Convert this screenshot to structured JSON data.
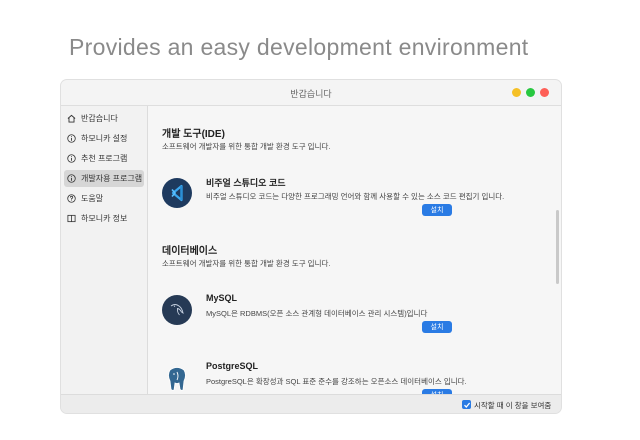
{
  "headline": "Provides an easy development environment",
  "window": {
    "title": "반갑습니다",
    "traffic_lights": [
      "#f5c026",
      "#28c840",
      "#fe5f57"
    ]
  },
  "sidebar": {
    "items": [
      {
        "label": "반갑습니다",
        "icon": "home-icon"
      },
      {
        "label": "하모니카 설정",
        "icon": "info-icon"
      },
      {
        "label": "추천 프로그램",
        "icon": "info-icon"
      },
      {
        "label": "개발자용 프로그램",
        "icon": "info-icon",
        "active": true
      },
      {
        "label": "도움말",
        "icon": "help-icon"
      },
      {
        "label": "하모니카 정보",
        "icon": "book-icon"
      }
    ]
  },
  "sections": [
    {
      "title": "개발 도구(IDE)",
      "description": "소프트웨어 개발자를 위한 통합 개발 환경 도구 입니다.",
      "apps": [
        {
          "name": "비주얼 스튜디오 코드",
          "description": "비주얼 스튜디오 코드는 다양한 프로그래밍 언어와 함께 사용할 수 있는 소스 코드 편집기 입니다.",
          "button": "설치",
          "icon": "vscode-icon"
        }
      ]
    },
    {
      "title": "데이터베이스",
      "description": "소프트웨어 개발자를 위한 통합 개발 환경 도구 입니다.",
      "apps": [
        {
          "name": "MySQL",
          "description": "MySQL은 RDBMS(오픈 소스 관계형 데이터베이스 관리 시스템)입니다",
          "button": "설치",
          "icon": "mysql-dolphin-icon"
        },
        {
          "name": "PostgreSQL",
          "description": "PostgreSQL은 확장성과 SQL 표준 준수를 강조하는 오픈소스 데이터베이스 입니다.",
          "button": "설치",
          "icon": "postgresql-elephant-icon"
        }
      ]
    }
  ],
  "footer": {
    "show_on_startup_label": "시작할 때 이 창을 보여줌",
    "show_on_startup_checked": true
  },
  "colors": {
    "accent": "#2a7be4",
    "vscode_bg": "#1e3a5f",
    "mysql_bg": "#263a55",
    "postgres_bg": "#336791"
  }
}
